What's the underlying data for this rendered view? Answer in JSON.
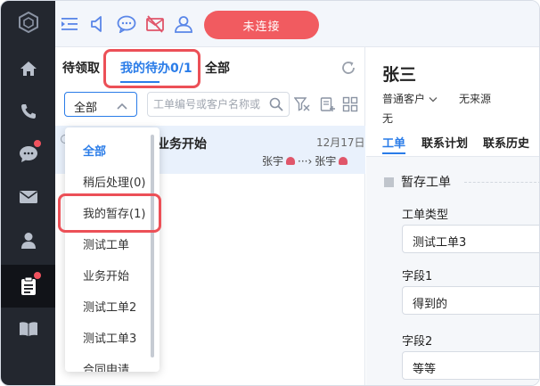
{
  "colors": {
    "accent": "#2a7ce8",
    "danger": "#f15b60",
    "nav_bg": "#23272f",
    "highlight": "#ec5057"
  },
  "nav": {
    "items": [
      {
        "name": "logo-icon"
      },
      {
        "name": "home-icon"
      },
      {
        "name": "phone-icon"
      },
      {
        "name": "chat-icon",
        "badge": true
      },
      {
        "name": "mail-icon"
      },
      {
        "name": "user-icon"
      },
      {
        "name": "clipboard-icon",
        "badge": true,
        "active": true
      },
      {
        "name": "book-icon"
      }
    ]
  },
  "topbar": {
    "icons": [
      "collapse-icon",
      "speaker-icon",
      "message-icon",
      "mail-off-icon",
      "contacts-icon"
    ],
    "connect_label": "未连接"
  },
  "middle": {
    "tabs": [
      {
        "label": "待领取",
        "active": false
      },
      {
        "label": "我的待办0/1",
        "active": true
      },
      {
        "label": "全部",
        "active": false
      }
    ],
    "filter": {
      "selected": "全部",
      "search_placeholder": "工单编号或客户名称或"
    },
    "rows": [
      {
        "title": "业务开始",
        "date": "12月17日",
        "from": "张宇",
        "arrow": "···›",
        "to": "张宇"
      }
    ],
    "dropdown": {
      "options": [
        "全部",
        "稍后处理(0)",
        "我的暂存(1)",
        "测试工单",
        "业务开始",
        "测试工单2",
        "测试工单3",
        "合同申请"
      ],
      "selected_index": 0
    }
  },
  "right": {
    "customer_name": "张三",
    "customer_type": "普通客户",
    "source": "无来源",
    "note": "无",
    "tabs": [
      {
        "label": "工单",
        "active": true
      },
      {
        "label": "联系计划",
        "active": false
      },
      {
        "label": "联系历史",
        "active": false
      }
    ],
    "section_title": "暂存工单",
    "fields": [
      {
        "label": "工单类型",
        "value": "测试工单3"
      },
      {
        "label": "字段1",
        "value": "得到的"
      },
      {
        "label": "字段2",
        "value": "等等"
      }
    ]
  }
}
